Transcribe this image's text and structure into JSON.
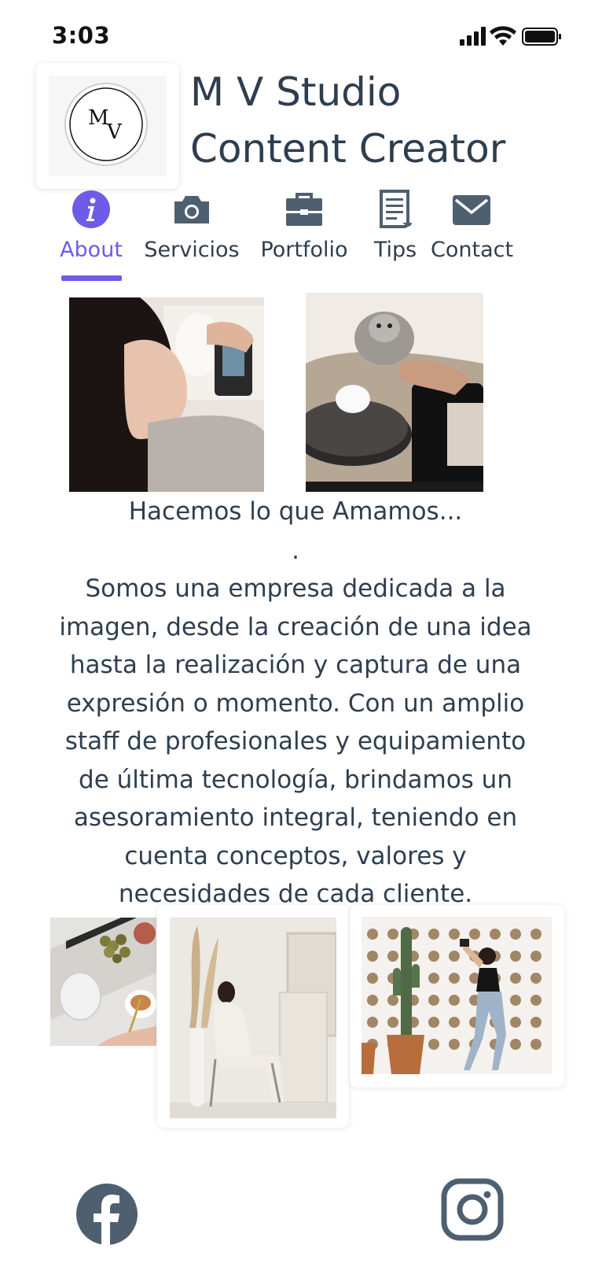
{
  "status_bar": {
    "time": "3:03"
  },
  "header": {
    "logo_text": "MV",
    "title_line1": "M V Studio",
    "title_line2": "Content Creator"
  },
  "nav": {
    "items": [
      {
        "label": "About",
        "icon": "info-icon",
        "active": true
      },
      {
        "label": "Servicios",
        "icon": "camera-icon",
        "active": false
      },
      {
        "label": "Portfolio",
        "icon": "briefcase-icon",
        "active": false
      },
      {
        "label": "Tips",
        "icon": "document-icon",
        "active": false
      },
      {
        "label": "Contact",
        "icon": "envelope-icon",
        "active": false
      }
    ]
  },
  "about": {
    "heading": "Hacemos lo que Amamos...",
    "separator": ".",
    "body": "Somos una empresa dedicada a la imagen, desde la creación de una idea hasta la realización y captura de una expresión o momento. Con un amplio staff de profesionales y equipamiento de última tecnología, brindamos un asesoramiento integral, teniendo en cuenta conceptos, valores y necesidades de cada cliente."
  },
  "footer": {
    "social": [
      {
        "icon": "facebook-icon"
      },
      {
        "icon": "instagram-icon"
      }
    ]
  },
  "colors": {
    "accent": "#6c5ce7",
    "text": "#2e3e4f",
    "icon": "#4e5f70"
  }
}
